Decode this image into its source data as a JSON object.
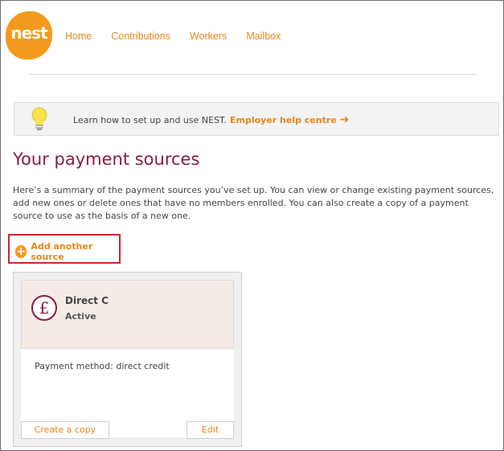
{
  "brand": {
    "logo_text": "nest"
  },
  "nav": {
    "items": [
      "Home",
      "Contributions",
      "Workers",
      "Mailbox"
    ]
  },
  "help": {
    "text": "Learn how to set up and use NEST.",
    "link_label": "Employer help centre",
    "icon": "lightbulb-icon"
  },
  "page": {
    "title": "Your payment sources",
    "intro": "Here’s a summary of the payment sources you’ve set up. You can view or change existing payment sources, add new ones or delete ones that have no members enrolled. You can also create a copy of a payment source to use as the basis of a new one."
  },
  "add_source": {
    "label": "Add another source",
    "icon": "plus-circle-icon"
  },
  "payment_source": {
    "icon": "pound-icon",
    "name": "Direct C",
    "status": "Active",
    "payment_method": "Payment method: direct credit",
    "copy_label": "Create a copy",
    "edit_label": "Edit"
  },
  "colors": {
    "accent": "#e8861c",
    "brand_orange": "#f39a1e",
    "title": "#8a1d3f",
    "highlight": "#d2232a"
  }
}
